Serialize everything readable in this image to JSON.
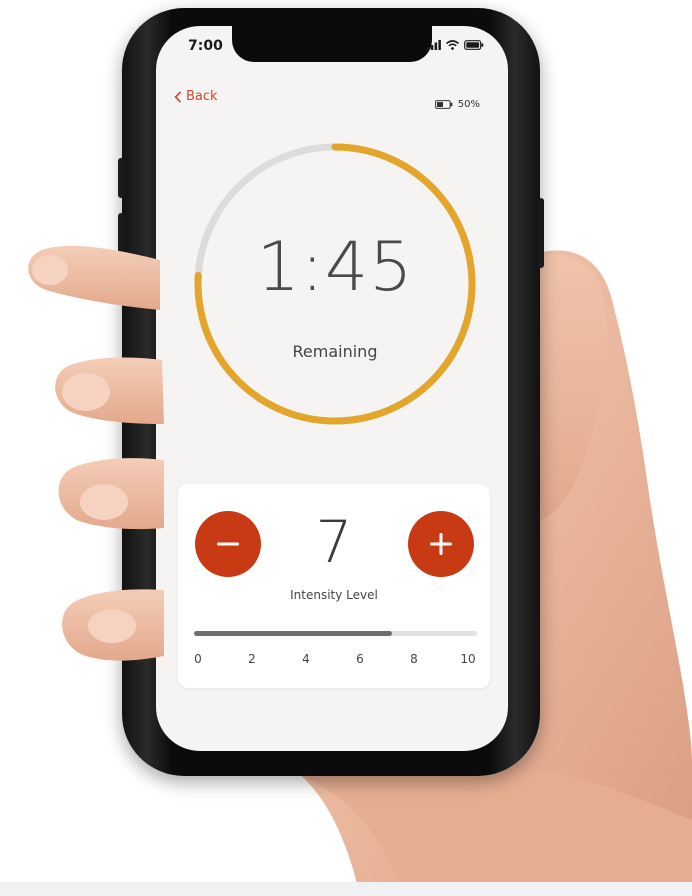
{
  "status_bar": {
    "time": "7:00",
    "icons": [
      "signal-icon",
      "wifi-icon",
      "battery-icon"
    ]
  },
  "header": {
    "back_label": "Back",
    "battery_text": "50%"
  },
  "timer": {
    "value": "1:45",
    "label": "Remaining",
    "progress_fraction": 0.76,
    "colors": {
      "progress": "#E3A62B",
      "track": "#DCDCDC"
    }
  },
  "intensity": {
    "value": "7",
    "label": "Intensity Level",
    "minus_icon": "minus-icon",
    "plus_icon": "plus-icon",
    "slider_level": 7,
    "slider_max": 10,
    "ticks": [
      "0",
      "2",
      "4",
      "6",
      "8",
      "10"
    ],
    "colors": {
      "button": "#C83A14",
      "fill": "#6F6F6F",
      "track": "#E2E2E2"
    }
  },
  "theme": {
    "accent": "#D5462A",
    "screen_bg": "#F5F4F2"
  }
}
